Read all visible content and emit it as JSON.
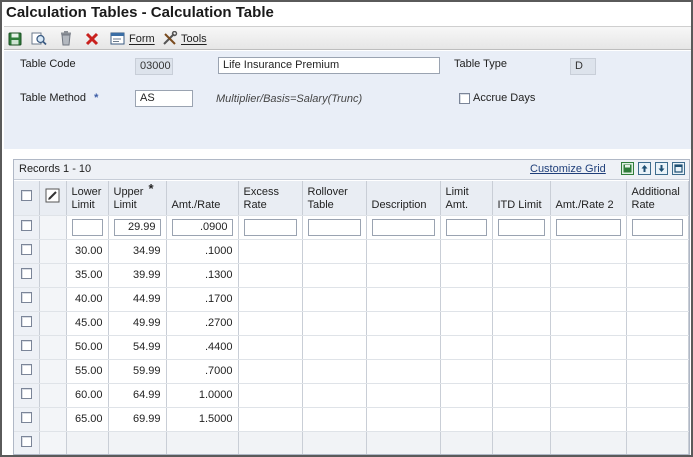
{
  "window": {
    "title": "Calculation Tables - Calculation Table"
  },
  "toolbar": {
    "form_label": "Form",
    "tools_label": "Tools"
  },
  "header": {
    "table_code_label": "Table Code",
    "table_code_value": "03000",
    "table_code_description": "Life Insurance Premium",
    "table_type_label": "Table Type",
    "table_type_value": "D",
    "table_method_label": "Table Method",
    "table_method_required": "*",
    "table_method_value": "AS",
    "method_description": "Multiplier/Basis=Salary(Trunc)",
    "accrue_days_label": "Accrue Days"
  },
  "grid": {
    "records_label": "Records 1 - 10",
    "customize_label": "Customize Grid",
    "columns": {
      "lower_limit": "Lower Limit",
      "upper_limit": "Upper Limit",
      "upper_limit_required": "*",
      "amt_rate": "Amt./Rate",
      "excess_rate": "Excess Rate",
      "rollover_table": "Rollover Table",
      "description": "Description",
      "limit_amt": "Limit Amt.",
      "itd_limit": "ITD Limit",
      "amt_rate_2": "Amt./Rate 2",
      "additional_rate": "Additional Rate"
    },
    "edit_row": {
      "upper": "29.99",
      "rate": ".0900"
    },
    "rows": [
      {
        "lower": "30.00",
        "upper": "34.99",
        "rate": ".1000"
      },
      {
        "lower": "35.00",
        "upper": "39.99",
        "rate": ".1300"
      },
      {
        "lower": "40.00",
        "upper": "44.99",
        "rate": ".1700"
      },
      {
        "lower": "45.00",
        "upper": "49.99",
        "rate": ".2700"
      },
      {
        "lower": "50.00",
        "upper": "54.99",
        "rate": ".4400"
      },
      {
        "lower": "55.00",
        "upper": "59.99",
        "rate": ".7000"
      },
      {
        "lower": "60.00",
        "upper": "64.99",
        "rate": "1.0000"
      },
      {
        "lower": "65.00",
        "upper": "69.99",
        "rate": "1.5000"
      }
    ]
  },
  "colors": {
    "header_bg": "#e9eef7",
    "required_asterisk": "#3b5ba5",
    "link": "#1f3f7a"
  },
  "icons": [
    "save-icon",
    "find-icon",
    "delete-icon",
    "close-icon",
    "form-icon",
    "tools-icon",
    "grid-save-icon",
    "export-icon",
    "import-icon",
    "maximize-icon",
    "row-edit-icon",
    "mouse-cursor-icon"
  ]
}
